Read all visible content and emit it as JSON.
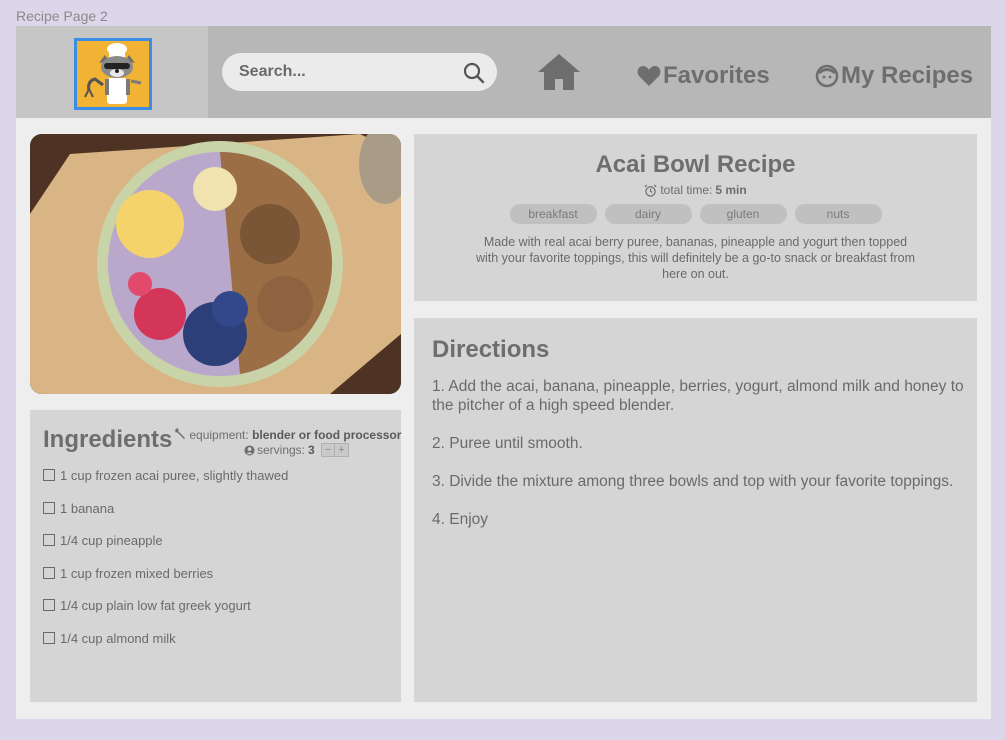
{
  "frame_label": "Recipe Page 2",
  "search": {
    "placeholder": "Search..."
  },
  "nav": {
    "favorites": "Favorites",
    "my_recipes": "My Recipes"
  },
  "recipe": {
    "title": "Acai Bowl Recipe",
    "total_time_label": "total time:",
    "total_time_value": "5 min",
    "tags": [
      "breakfast",
      "dairy",
      "gluten",
      "nuts"
    ],
    "description": "Made with real acai berry puree, bananas, pineapple and yogurt then topped with your favorite toppings, this will definitely be a go-to snack or breakfast from here on out."
  },
  "ingredients": {
    "title": "Ingredients",
    "equipment_label": "equipment:",
    "equipment_value": "blender or food processor",
    "servings_label": "servings:",
    "servings_value": "3",
    "stepper_minus": "−",
    "stepper_plus": "+",
    "items": [
      "1 cup frozen acai puree, slightly thawed",
      "1 banana",
      "1/4 cup pineapple",
      "1 cup frozen mixed berries",
      "1/4 cup plain low fat greek yogurt",
      "1/4 cup almond milk"
    ]
  },
  "directions": {
    "title": "Directions",
    "steps": [
      "1. Add the acai, banana, pineapple, berries, yogurt, almond milk and honey to the pitcher of a high speed blender.",
      "2. Puree until smooth.",
      "3. Divide the mixture among three bowls and top with your favorite toppings.",
      "4. Enjoy"
    ]
  },
  "colors": {
    "accent_border": "#3a8ee6",
    "panel": "#d5d5d5",
    "topbar": "#b7b7b7",
    "background": "#ddd6ea"
  }
}
